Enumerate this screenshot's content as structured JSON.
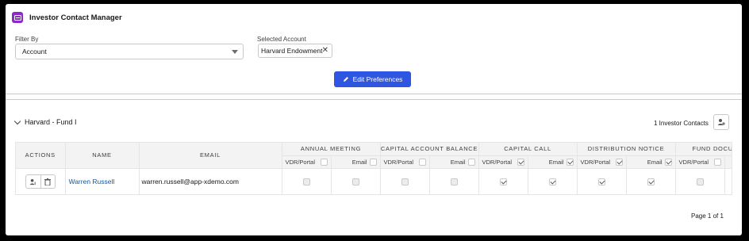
{
  "app": {
    "title": "Investor Contact Manager",
    "icon": "id-card-icon",
    "icon_color": "#8c2ac7"
  },
  "filters": {
    "filter_by_label": "Filter By",
    "filter_by_value": "Account",
    "selected_account_label": "Selected Account",
    "selected_account_value": "Harvard Endowment"
  },
  "actions": {
    "edit_preferences_label": "Edit Preferences",
    "brand_color": "#2e56e0"
  },
  "section": {
    "title": "Harvard - Fund I",
    "contacts_count": "1 Investor Contacts"
  },
  "table": {
    "columns": {
      "actions": "ACTIONS",
      "name": "NAME",
      "email": "EMAIL"
    },
    "groups": [
      {
        "label": "ANNUAL MEETING"
      },
      {
        "label": "CAPITAL ACCOUNT BALANCE"
      },
      {
        "label": "CAPITAL CALL"
      },
      {
        "label": "DISTRIBUTION NOTICE"
      },
      {
        "label": "FUND DOCUMENTS"
      }
    ],
    "sub_vdr": "VDR/Portal",
    "sub_email": "Email",
    "rows": [
      {
        "name": "Warren Russell",
        "email": "warren.russell@app-xdemo.com"
      }
    ]
  },
  "pager": {
    "text": "Page 1 of 1"
  }
}
